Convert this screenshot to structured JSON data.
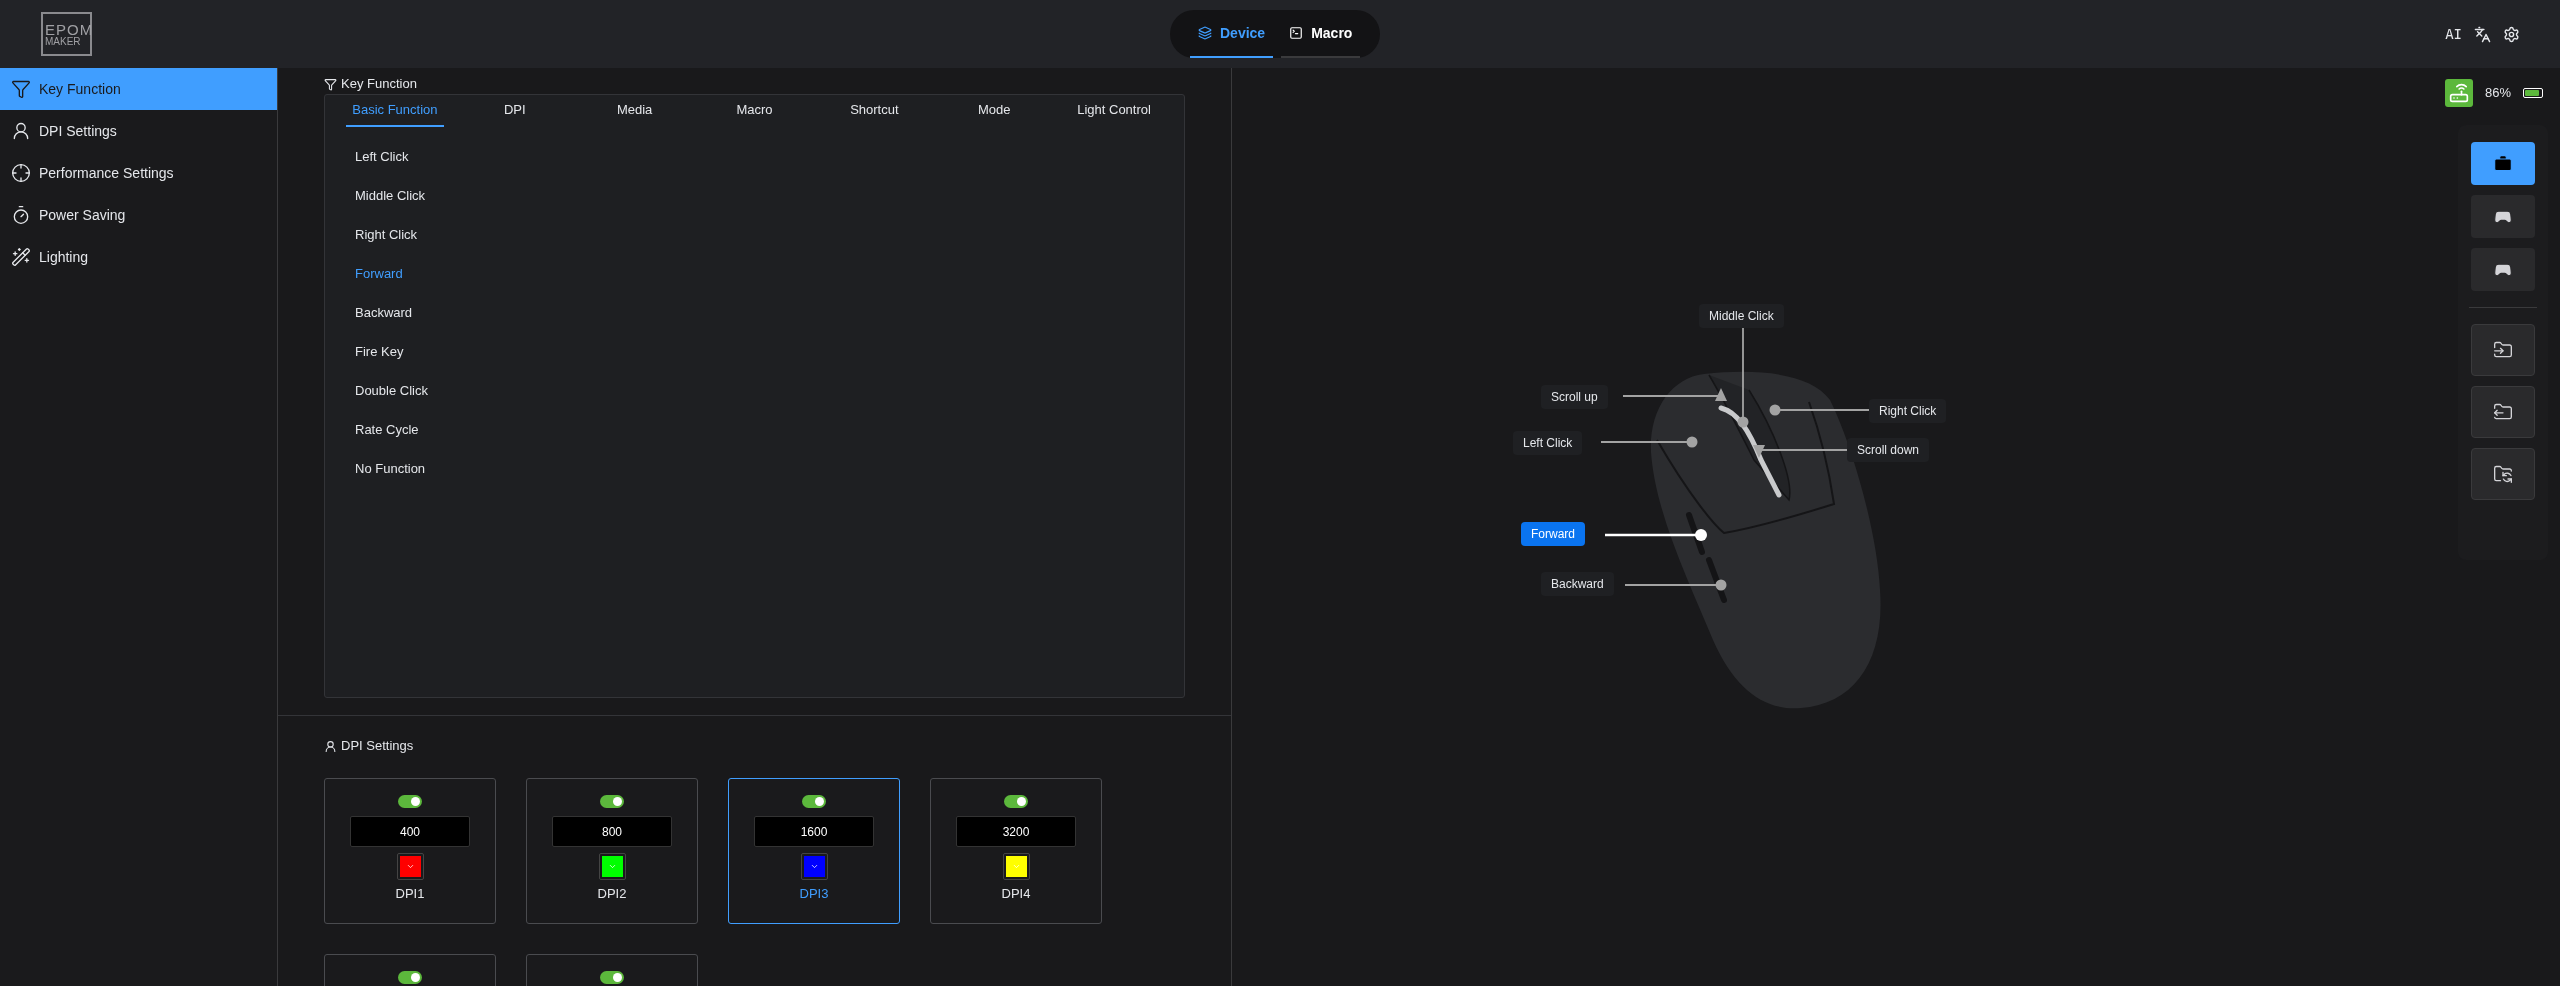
{
  "logo": {
    "line1": "EPOM",
    "line2": "MAKER"
  },
  "top_tabs": [
    {
      "label": "Device",
      "selected": true
    },
    {
      "label": "Macro",
      "selected": false
    }
  ],
  "header_right": {
    "ai_label": "AI"
  },
  "sidebar": {
    "items": [
      {
        "label": "Key Function",
        "selected": true
      },
      {
        "label": "DPI Settings",
        "selected": false
      },
      {
        "label": "Performance Settings",
        "selected": false
      },
      {
        "label": "Power Saving",
        "selected": false
      },
      {
        "label": "Lighting",
        "selected": false
      }
    ]
  },
  "key_function": {
    "title": "Key Function",
    "tabs": [
      {
        "label": "Basic Function",
        "selected": true
      },
      {
        "label": "DPI",
        "selected": false
      },
      {
        "label": "Media",
        "selected": false
      },
      {
        "label": "Macro",
        "selected": false
      },
      {
        "label": "Shortcut",
        "selected": false
      },
      {
        "label": "Mode",
        "selected": false
      },
      {
        "label": "Light Control",
        "selected": false
      }
    ],
    "items": [
      {
        "label": "Left Click",
        "selected": false
      },
      {
        "label": "Middle Click",
        "selected": false
      },
      {
        "label": "Right Click",
        "selected": false
      },
      {
        "label": "Forward",
        "selected": true
      },
      {
        "label": "Backward",
        "selected": false
      },
      {
        "label": "Fire Key",
        "selected": false
      },
      {
        "label": "Double Click",
        "selected": false
      },
      {
        "label": "Rate Cycle",
        "selected": false
      },
      {
        "label": "No Function",
        "selected": false
      }
    ]
  },
  "dpi_settings": {
    "title": "DPI Settings",
    "cards": [
      {
        "enabled": true,
        "value": "400",
        "color": "#ff0000",
        "label": "DPI1",
        "selected": false
      },
      {
        "enabled": true,
        "value": "800",
        "color": "#00ff00",
        "label": "DPI2",
        "selected": false
      },
      {
        "enabled": true,
        "value": "1600",
        "color": "#0000ff",
        "label": "DPI3",
        "selected": true
      },
      {
        "enabled": true,
        "value": "3200",
        "color": "#ffff00",
        "label": "DPI4",
        "selected": false
      },
      {
        "enabled": true,
        "selected": false
      },
      {
        "enabled": true,
        "selected": false
      }
    ]
  },
  "status": {
    "battery": "86%",
    "level": 0.86
  },
  "toolbar": [
    {
      "selected": true
    },
    {
      "selected": false
    },
    {
      "selected": false
    },
    {
      "selected": false
    },
    {
      "selected": false
    },
    {
      "selected": false
    }
  ],
  "mouse_labels": [
    {
      "label": "Middle Click",
      "selected": false
    },
    {
      "label": "Scroll up",
      "selected": false
    },
    {
      "label": "Right Click",
      "selected": false
    },
    {
      "label": "Left Click",
      "selected": false
    },
    {
      "label": "Scroll down",
      "selected": false
    },
    {
      "label": "Forward",
      "selected": true
    },
    {
      "label": "Backward",
      "selected": false
    }
  ]
}
